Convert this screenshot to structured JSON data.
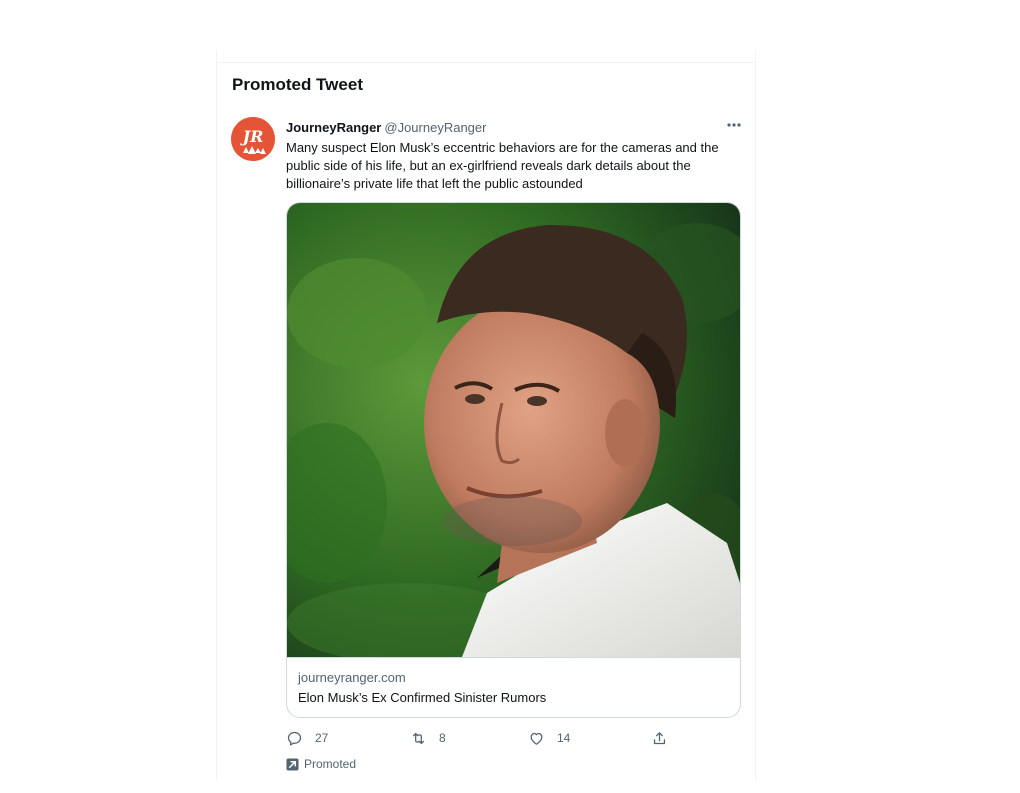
{
  "section": {
    "title": "Promoted Tweet"
  },
  "tweet": {
    "author_name": "JourneyRanger",
    "author_handle": "@JourneyRanger",
    "avatar_initials": "JR",
    "text": "Many suspect Elon Musk’s eccentric behaviors are for the cameras and the public side of his life, but an ex-girlfriend reveals dark details about the billionaire’s private life that left the public astounded",
    "card": {
      "domain": "journeyranger.com",
      "title": "Elon Musk’s Ex Confirmed Sinister Rumors"
    },
    "actions": {
      "reply_count": "27",
      "retweet_count": "8",
      "like_count": "14"
    },
    "promoted_label": "Promoted"
  },
  "icons": {
    "more": "more-dots-icon",
    "reply": "reply-icon",
    "retweet": "retweet-icon",
    "like": "heart-icon",
    "share": "share-icon",
    "promoted": "promoted-arrow-icon"
  },
  "colors": {
    "avatar_bg": "#e55436",
    "text_secondary": "#536471",
    "border": "#cfd9de"
  }
}
